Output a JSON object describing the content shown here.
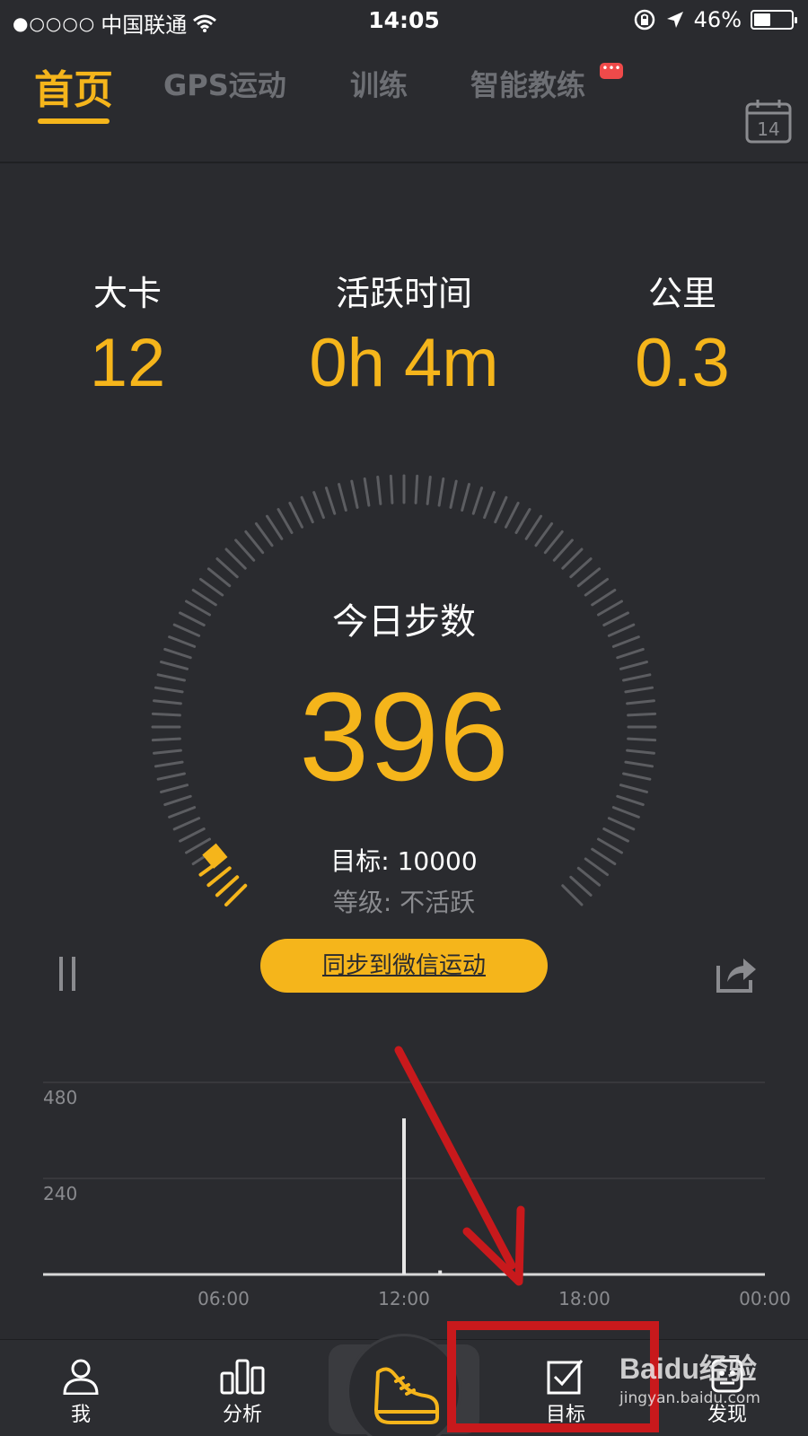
{
  "status_bar": {
    "signal": "●○○○○",
    "carrier": "中国联通",
    "time": "14:05",
    "battery": "46%",
    "battery_level": 0.46
  },
  "tabs": [
    {
      "label": "首页",
      "active": true
    },
    {
      "label": "GPS运动",
      "active": false
    },
    {
      "label": "训练",
      "active": false
    },
    {
      "label": "智能教练",
      "active": false,
      "badge": "•••"
    }
  ],
  "calendar_day": "14",
  "stats": [
    {
      "label": "大卡",
      "value": "12"
    },
    {
      "label": "活跃时间",
      "value": "0h 4m"
    },
    {
      "label": "公里",
      "value": "0.3"
    }
  ],
  "gauge": {
    "title": "今日步数",
    "value": "396",
    "goal": "目标: 10000",
    "level": "等级: 不活跃",
    "progress": 0.0396
  },
  "sync_button": "同步到微信运动",
  "chart_data": {
    "type": "bar",
    "y_ticks": [
      "480",
      "240"
    ],
    "x_ticks": [
      "06:00",
      "12:00",
      "18:00",
      "00:00"
    ],
    "ylim": [
      0,
      480
    ],
    "x_range_hours": [
      0,
      24
    ],
    "bars": [
      {
        "hour": 12.0,
        "value": 390
      },
      {
        "hour": 13.2,
        "value": 10
      }
    ],
    "accent": "#f5b51b"
  },
  "tabbar": [
    {
      "label": "我",
      "icon": "person-icon"
    },
    {
      "label": "分析",
      "icon": "bar-chart-icon"
    },
    {
      "label": "",
      "icon": "shoe-icon"
    },
    {
      "label": "目标",
      "icon": "checkbox-icon"
    },
    {
      "label": "发现",
      "icon": "robot-icon"
    }
  ],
  "watermark": {
    "brand": "Baidu经验",
    "url": "jingyan.baidu.com"
  },
  "colors": {
    "accent": "#f5b51b",
    "background": "#2a2b2f",
    "annotation": "#c8191c"
  }
}
